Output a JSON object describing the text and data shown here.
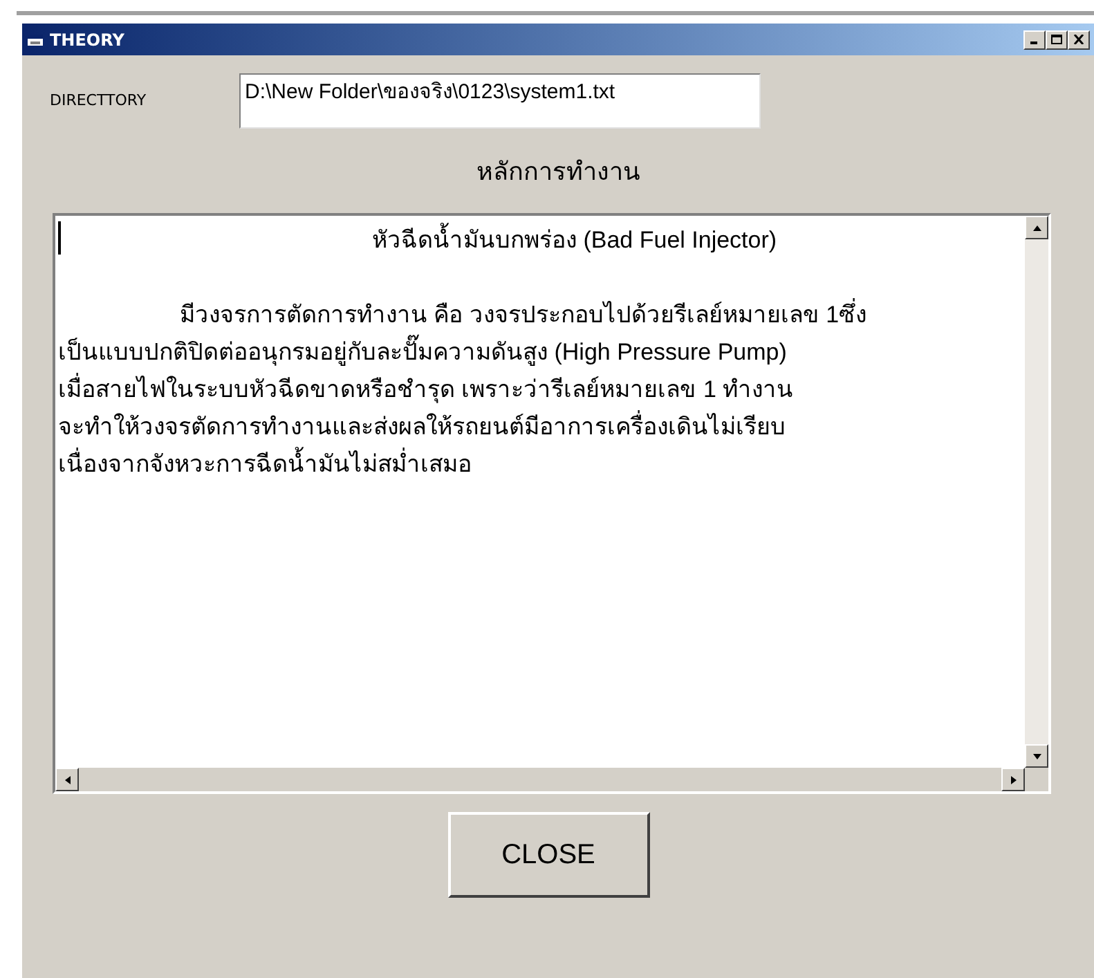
{
  "window": {
    "title": "THEORY"
  },
  "directory": {
    "label": "DIRECTTORY",
    "value": "D:\\New Folder\\ของจริง\\0123\\system1.txt"
  },
  "heading": "หลักการทำงาน",
  "text_area": {
    "title_line": "หัวฉีดน้ำมันบกพร่อง (Bad Fuel Injector)",
    "lines": [
      "มีวงจรการตัดการทำงาน คือ วงจรประกอบไปด้วยรีเลย์หมายเลข 1ซึ่ง",
      "เป็นแบบปกติปิดต่ออนุกรมอยู่กับละปั๊มความดันสูง (High Pressure Pump)",
      "เมื่อสายไฟในระบบหัวฉีดขาดหรือชำรุด เพราะว่ารีเลย์หมายเลข 1 ทำงาน",
      "จะทำให้วงจรตัดการทำงานและส่งผลให้รถยนต์มีอาการเครื่องเดินไม่เรียบ",
      "เนื่องจากจังหวะการฉีดน้ำมันไม่สม่ำเสมอ"
    ]
  },
  "buttons": [
    "CLOSE"
  ]
}
